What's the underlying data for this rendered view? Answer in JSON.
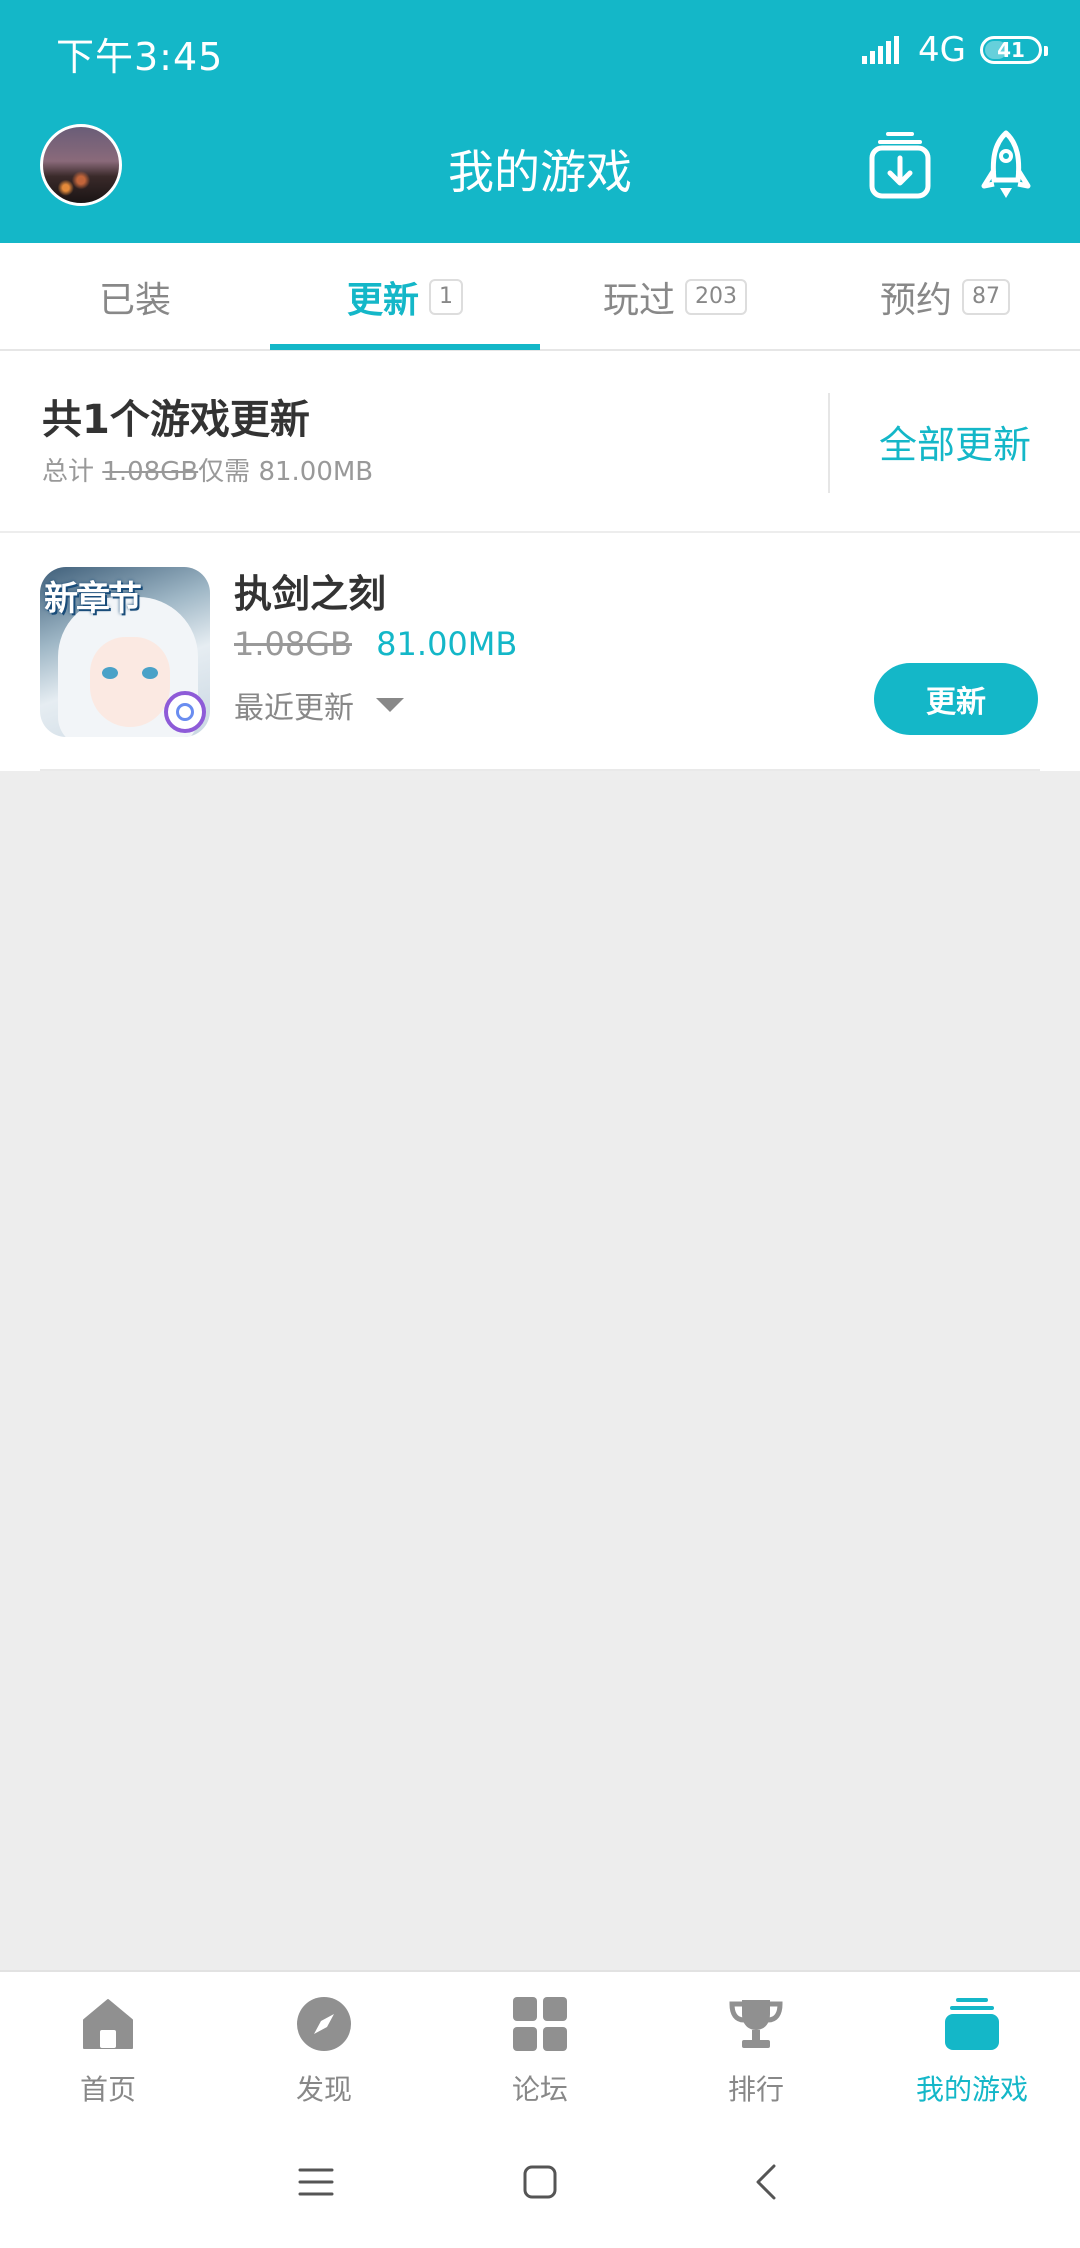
{
  "status_bar": {
    "time": "下午3:45",
    "network": "4G",
    "battery": "41"
  },
  "header": {
    "title": "我的游戏"
  },
  "tabs": [
    {
      "label": "已装",
      "badge": ""
    },
    {
      "label": "更新",
      "badge": "1"
    },
    {
      "label": "玩过",
      "badge": "203"
    },
    {
      "label": "预约",
      "badge": "87"
    }
  ],
  "summary": {
    "title": "共1个游戏更新",
    "total_label": "总计",
    "total_size": "1.08GB",
    "only_label": "仅需",
    "only_size": "81.00MB",
    "update_all_label": "全部更新"
  },
  "games": [
    {
      "icon_banner": "新章节",
      "name": "执剑之刻",
      "old_size": "1.08GB",
      "new_size": "81.00MB",
      "recent_label": "最近更新",
      "update_label": "更新"
    }
  ],
  "bottom_nav": [
    {
      "label": "首页",
      "icon": "home-icon"
    },
    {
      "label": "发现",
      "icon": "compass-icon"
    },
    {
      "label": "论坛",
      "icon": "grid-icon"
    },
    {
      "label": "排行",
      "icon": "trophy-icon"
    },
    {
      "label": "我的游戏",
      "icon": "stack-icon"
    }
  ],
  "colors": {
    "accent": "#14b7c8",
    "background": "#ededed"
  }
}
